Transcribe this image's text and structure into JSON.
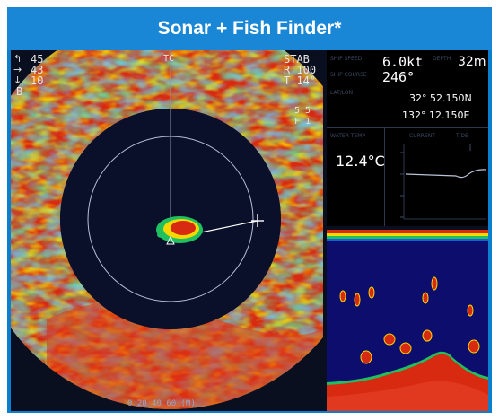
{
  "banner": {
    "title": "Sonar + Fish Finder*"
  },
  "sonar": {
    "left_readouts": [
      "45",
      "43",
      "10",
      "B"
    ],
    "tilt_top": "TC",
    "stab": "STAB",
    "range": "R 100",
    "tilt": "T 14°",
    "side_values": [
      "5 5",
      "F 1"
    ],
    "bottom_scale": "0 20 40 60 (M)"
  },
  "info": {
    "speed_label": "SHIP SPEED",
    "speed_value": "6.0kt",
    "depth_label": "DEPTH",
    "depth_value": "32m",
    "course_label": "SHIP COURSE",
    "course_value": "246°",
    "latlon_label": "LAT/LON",
    "lat_value": "32° 52.150N",
    "lon_value": "132° 12.150E",
    "water_temp_label": "WATER TEMP",
    "water_temp_value": "12.4°C",
    "graph_label": "CURRENT",
    "graph_label2": "TIDE"
  },
  "colors": {
    "background": "#0a0f1f",
    "frame": "#0a7fd0",
    "banner": "#1a87d6",
    "echo_red": "#d82a10",
    "echo_yellow": "#f5d800",
    "echo_green": "#1fc060",
    "fishfinder_water": "#0d0d6e"
  }
}
